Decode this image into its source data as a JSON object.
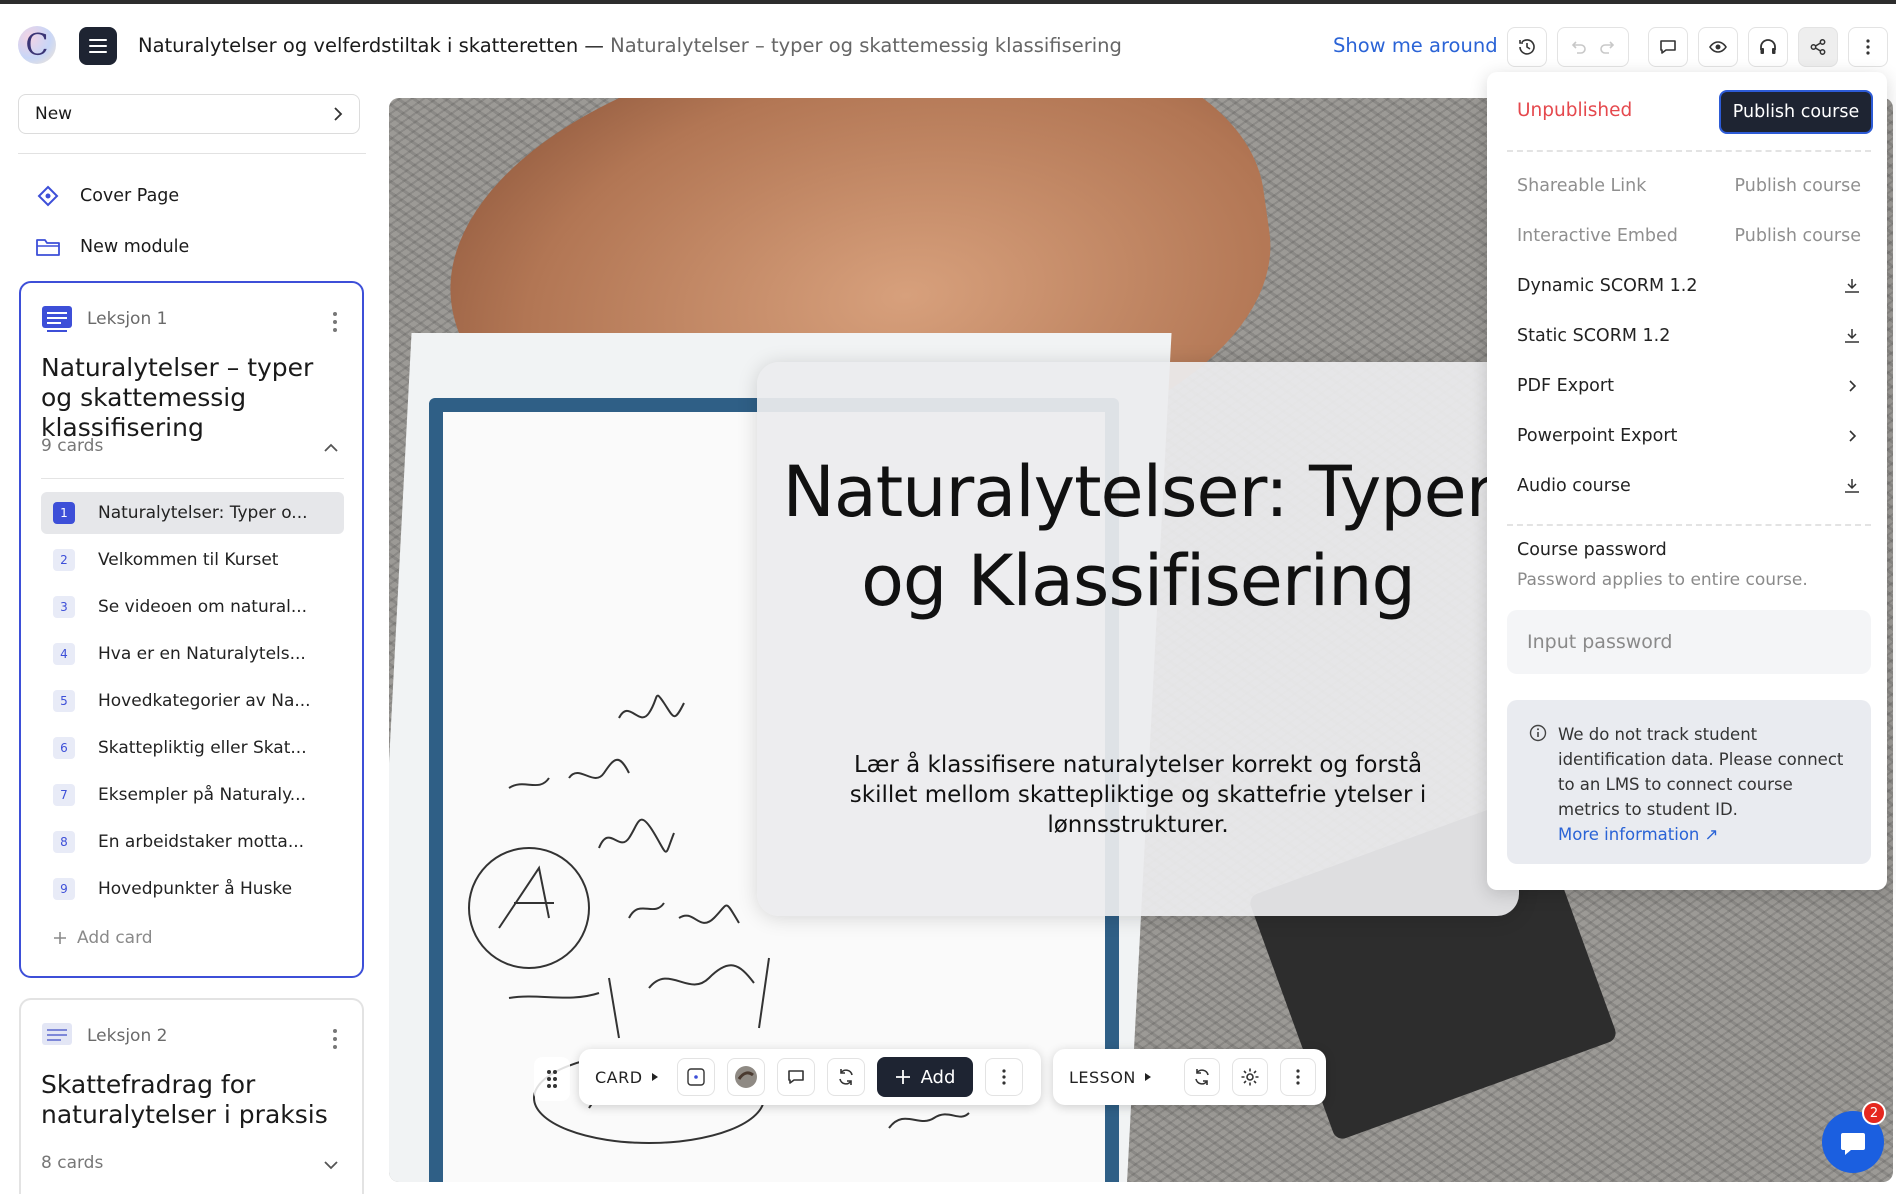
{
  "header": {
    "logo_letter": "C",
    "course_title": "Naturalytelser og velferdstiltak i skatteretten",
    "separator": " — ",
    "lesson_title": "Naturalytelser – typer og skattemessig klassifisering",
    "show_around": "Show me around"
  },
  "sidebar": {
    "new_label": "New",
    "cover_page": "Cover Page",
    "new_module": "New module",
    "lessons": [
      {
        "label": "Leksjon 1",
        "title": "Naturalytelser – typer og skattemessig klassifisering",
        "count": "9 cards",
        "cards": [
          {
            "num": "1",
            "title": "Naturalytelser: Typer o..."
          },
          {
            "num": "2",
            "title": "Velkommen til Kurset"
          },
          {
            "num": "3",
            "title": "Se videoen om natural..."
          },
          {
            "num": "4",
            "title": "Hva er en Naturalytels..."
          },
          {
            "num": "5",
            "title": "Hovedkategorier av Na..."
          },
          {
            "num": "6",
            "title": "Skattepliktig eller Skat..."
          },
          {
            "num": "7",
            "title": "Eksempler på Naturaly..."
          },
          {
            "num": "8",
            "title": "En arbeidstaker motta..."
          },
          {
            "num": "9",
            "title": "Hovedpunkter å Huske"
          }
        ],
        "add_card": "Add card"
      },
      {
        "label": "Leksjon 2",
        "title": "Skattefradrag for naturalytelser i praksis",
        "count": "8 cards"
      }
    ]
  },
  "cover": {
    "title": "Naturalytelser: Typer og Klassifisering",
    "subtitle": "Lær å klassifisere naturalytelser korrekt og forstå skillet mellom skattepliktige og skattefrie ytelser i lønnsstrukturer."
  },
  "toolbar": {
    "card_label": "CARD",
    "add_label": "Add",
    "lesson_label": "LESSON"
  },
  "share_panel": {
    "status": "Unpublished",
    "publish_button": "Publish course",
    "rows": [
      {
        "label": "Shareable Link",
        "action": "Publish course"
      },
      {
        "label": "Interactive Embed",
        "action": "Publish course"
      },
      {
        "label": "Dynamic SCORM 1.2",
        "icon": "download-icon"
      },
      {
        "label": "Static SCORM 1.2",
        "icon": "download-icon"
      },
      {
        "label": "PDF Export",
        "icon": "chevron-right-icon"
      },
      {
        "label": "Powerpoint Export",
        "icon": "chevron-right-icon"
      },
      {
        "label": "Audio course",
        "icon": "download-icon"
      }
    ],
    "password_title": "Course password",
    "password_desc": "Password applies to entire course.",
    "password_placeholder": "Input password",
    "info_text": "We do not track student identification data. Please connect to an LMS to connect course metrics to student ID.",
    "info_link": "More information ↗"
  },
  "chat": {
    "badge_count": "2"
  },
  "colors": {
    "accent": "#3d4fd8",
    "dark_button": "#1e2432",
    "link": "#2a63d6",
    "unpublished": "#e5484d"
  }
}
